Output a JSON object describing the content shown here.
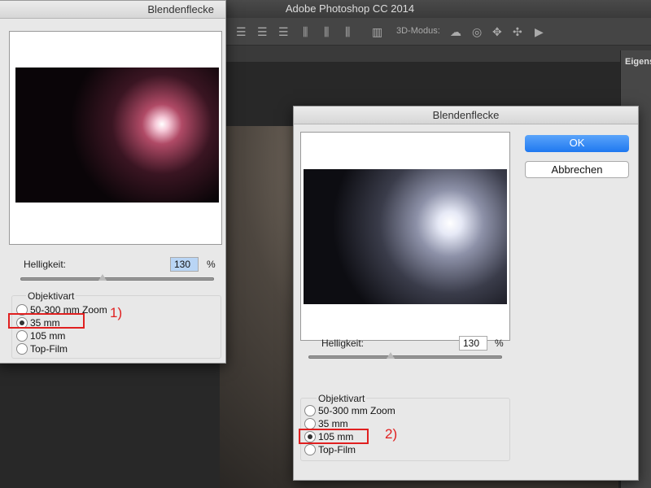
{
  "app": {
    "title": "Adobe Photoshop CC 2014"
  },
  "toolbar": {
    "mode_label": "3D-Modus:",
    "icons": [
      "align-top-icon",
      "align-vcenter-icon",
      "align-bottom-icon",
      "align-left-icon",
      "align-hcenter-icon",
      "align-right-icon",
      "auto-align-icon",
      "rotate-3d-icon",
      "roll-3d-icon",
      "drag-3d-icon",
      "slide-3d-icon",
      "scale-3d-icon"
    ]
  },
  "right_panel": {
    "title": "Eigens"
  },
  "dialog1": {
    "title": "Blendenflecke",
    "brightness_label": "Helligkeit:",
    "brightness_value": "130",
    "percent": "%",
    "brightness_percent": 130,
    "group_label": "Objektivart",
    "options": [
      "50-300 mm Zoom",
      "35 mm",
      "105 mm",
      "Top-Film"
    ],
    "selected": "35 mm",
    "annotation": "1)"
  },
  "dialog2": {
    "title": "Blendenflecke",
    "ok": "OK",
    "cancel": "Abbrechen",
    "brightness_label": "Helligkeit:",
    "brightness_value": "130",
    "percent": "%",
    "brightness_percent": 130,
    "group_label": "Objektivart",
    "options": [
      "50-300 mm Zoom",
      "35 mm",
      "105 mm",
      "Top-Film"
    ],
    "selected": "105 mm",
    "annotation": "2)"
  },
  "colors": {
    "ok_button": "#2f86f5",
    "annotation": "#e02020"
  }
}
